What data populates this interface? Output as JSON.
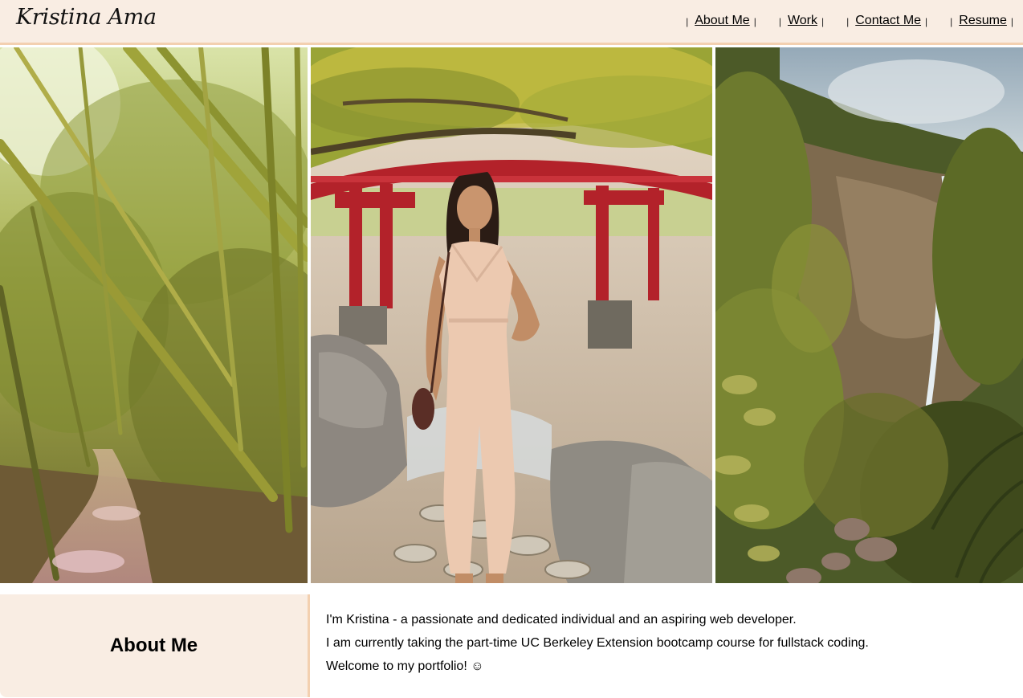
{
  "header": {
    "brand": "Kristina Ama",
    "nav": [
      {
        "label": "About Me"
      },
      {
        "label": "Work"
      },
      {
        "label": "Contact Me"
      },
      {
        "label": "Resume"
      }
    ],
    "separator": "|"
  },
  "hero": {
    "photos": [
      {
        "subject": "bamboo forest path"
      },
      {
        "subject": "woman in front of red japanese bridge"
      },
      {
        "subject": "jungle waterfall"
      }
    ]
  },
  "about": {
    "heading": "About Me",
    "paragraphs": [
      "I'm Kristina - a passionate and dedicated individual and an aspiring web developer.",
      "I am currently taking the part-time UC Berkeley Extension bootcamp course for fullstack coding.",
      "Welcome to my portfolio! ☺"
    ]
  },
  "colors": {
    "header_bg": "#f9ede3",
    "accent_border": "#f3d0b0",
    "text": "#000000"
  }
}
